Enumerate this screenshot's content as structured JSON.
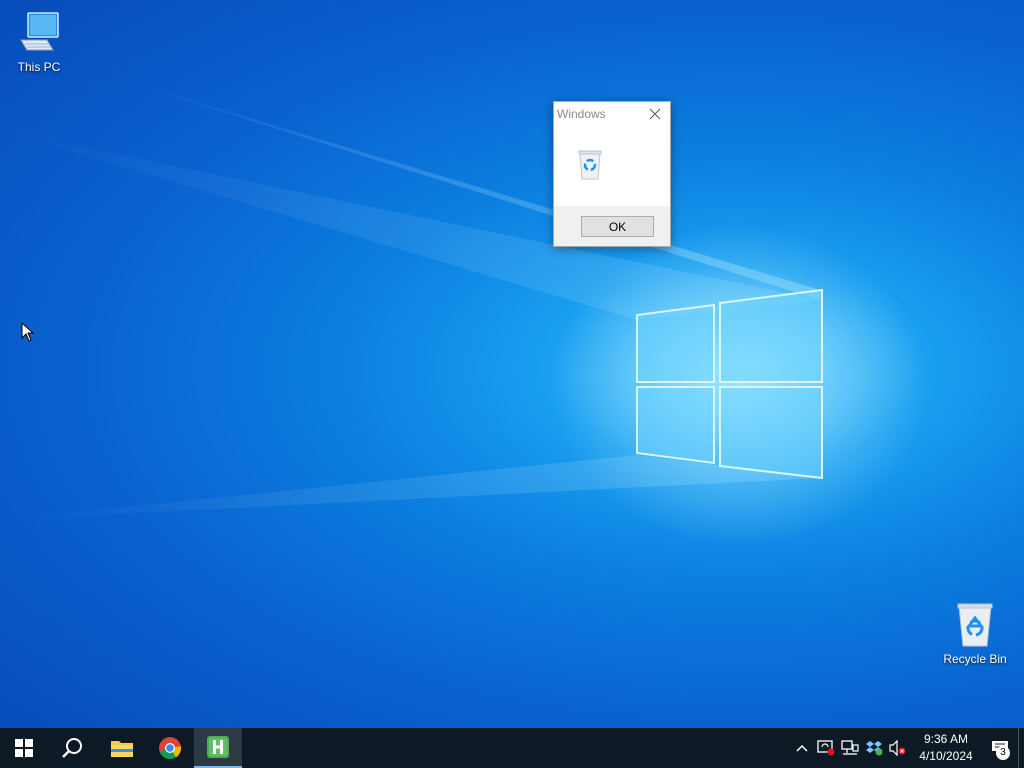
{
  "desktop": {
    "icons": [
      {
        "label": "This PC",
        "icon": "computer-icon"
      },
      {
        "label": "Recycle Bin",
        "icon": "recycle-bin-icon"
      }
    ]
  },
  "dialog": {
    "title": "Windows",
    "icon": "recycle-bin-icon",
    "ok_label": "OK"
  },
  "taskbar": {
    "apps": [
      {
        "name": "start",
        "icon": "windows-start-icon"
      },
      {
        "name": "search",
        "icon": "search-icon"
      },
      {
        "name": "file-explorer",
        "icon": "folder-icon"
      },
      {
        "name": "chrome",
        "icon": "chrome-icon"
      },
      {
        "name": "h-app",
        "icon": "h-app-icon",
        "active": true
      }
    ],
    "tray": {
      "icons": [
        "chevron-up-icon",
        "security-alert-icon",
        "network-icon",
        "dropbox-icon",
        "volume-muted-icon"
      ],
      "time": "9:36 AM",
      "date": "4/10/2024",
      "notification_count": "3"
    }
  },
  "colors": {
    "taskbar_bg": "#0d1a26",
    "accent": "#76b9ed",
    "desktop_blue": "#0a63d0"
  }
}
